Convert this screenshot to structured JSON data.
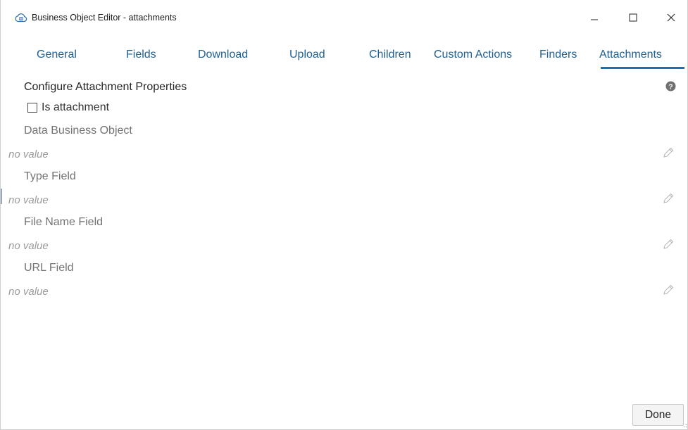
{
  "window": {
    "title": "Business Object Editor - attachments",
    "app_icon": "cloud-icon",
    "controls": {
      "minimize_icon": "minimize-icon",
      "maximize_icon": "maximize-icon",
      "close_icon": "close-icon"
    }
  },
  "tabs": [
    {
      "label": "General"
    },
    {
      "label": "Fields"
    },
    {
      "label": "Download"
    },
    {
      "label": "Upload"
    },
    {
      "label": "Children"
    },
    {
      "label": "Custom Actions"
    },
    {
      "label": "Finders"
    },
    {
      "label": "Attachments",
      "active": true
    }
  ],
  "content": {
    "section_title": "Configure Attachment Properties",
    "help_icon": "help-icon",
    "is_attachment": {
      "label": "Is attachment",
      "checked": false
    },
    "fields": [
      {
        "label": "Data Business Object",
        "value": "no value",
        "edit_icon": "pencil-icon"
      },
      {
        "label": "Type Field",
        "value": "no value",
        "edit_icon": "pencil-icon"
      },
      {
        "label": "File Name Field",
        "value": "no value",
        "edit_icon": "pencil-icon"
      },
      {
        "label": "URL Field",
        "value": "no value",
        "edit_icon": "pencil-icon"
      }
    ]
  },
  "footer": {
    "done_label": "Done"
  },
  "colors": {
    "tab_text": "#1f5f93",
    "tab_underline": "#1f6fb0",
    "label_gray": "#737373",
    "value_gray": "#9a9a9a"
  }
}
